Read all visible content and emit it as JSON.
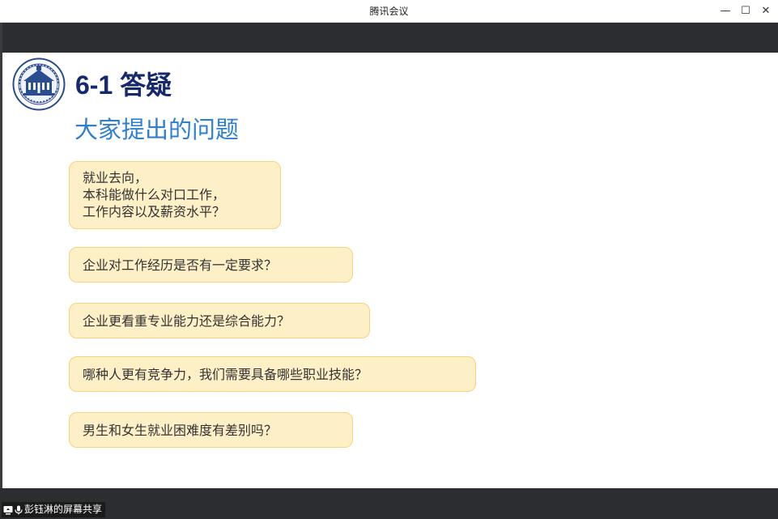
{
  "window": {
    "title": "腾讯会议",
    "controls": {
      "minimize": "—",
      "maximize": "☐",
      "close": "✕"
    }
  },
  "slide": {
    "heading": "6-1 答疑",
    "subheading": "大家提出的问题",
    "questions": [
      {
        "lines": [
          "就业去向，",
          "本科能做什么对口工作，",
          "工作内容以及薪资水平？"
        ]
      },
      {
        "lines": [
          "企业对工作经历是否有一定要求？"
        ]
      },
      {
        "lines": [
          "企业更看重专业能力还是综合能力？"
        ]
      },
      {
        "lines": [
          "哪种人更有竞争力，我们需要具备哪些职业技能？"
        ]
      },
      {
        "lines": [
          "男生和女生就业困难度有差别吗？"
        ]
      }
    ]
  },
  "status": {
    "share_label": "彭钰淋的屏幕共享",
    "icons": [
      "screen-share-icon",
      "microphone-icon"
    ]
  },
  "colors": {
    "heading": "#16286e",
    "subheading": "#2f7fd0",
    "bubble_fill": "#fdefc6",
    "bubble_border": "#f6d37e",
    "toolbar": "#2b2d30"
  }
}
